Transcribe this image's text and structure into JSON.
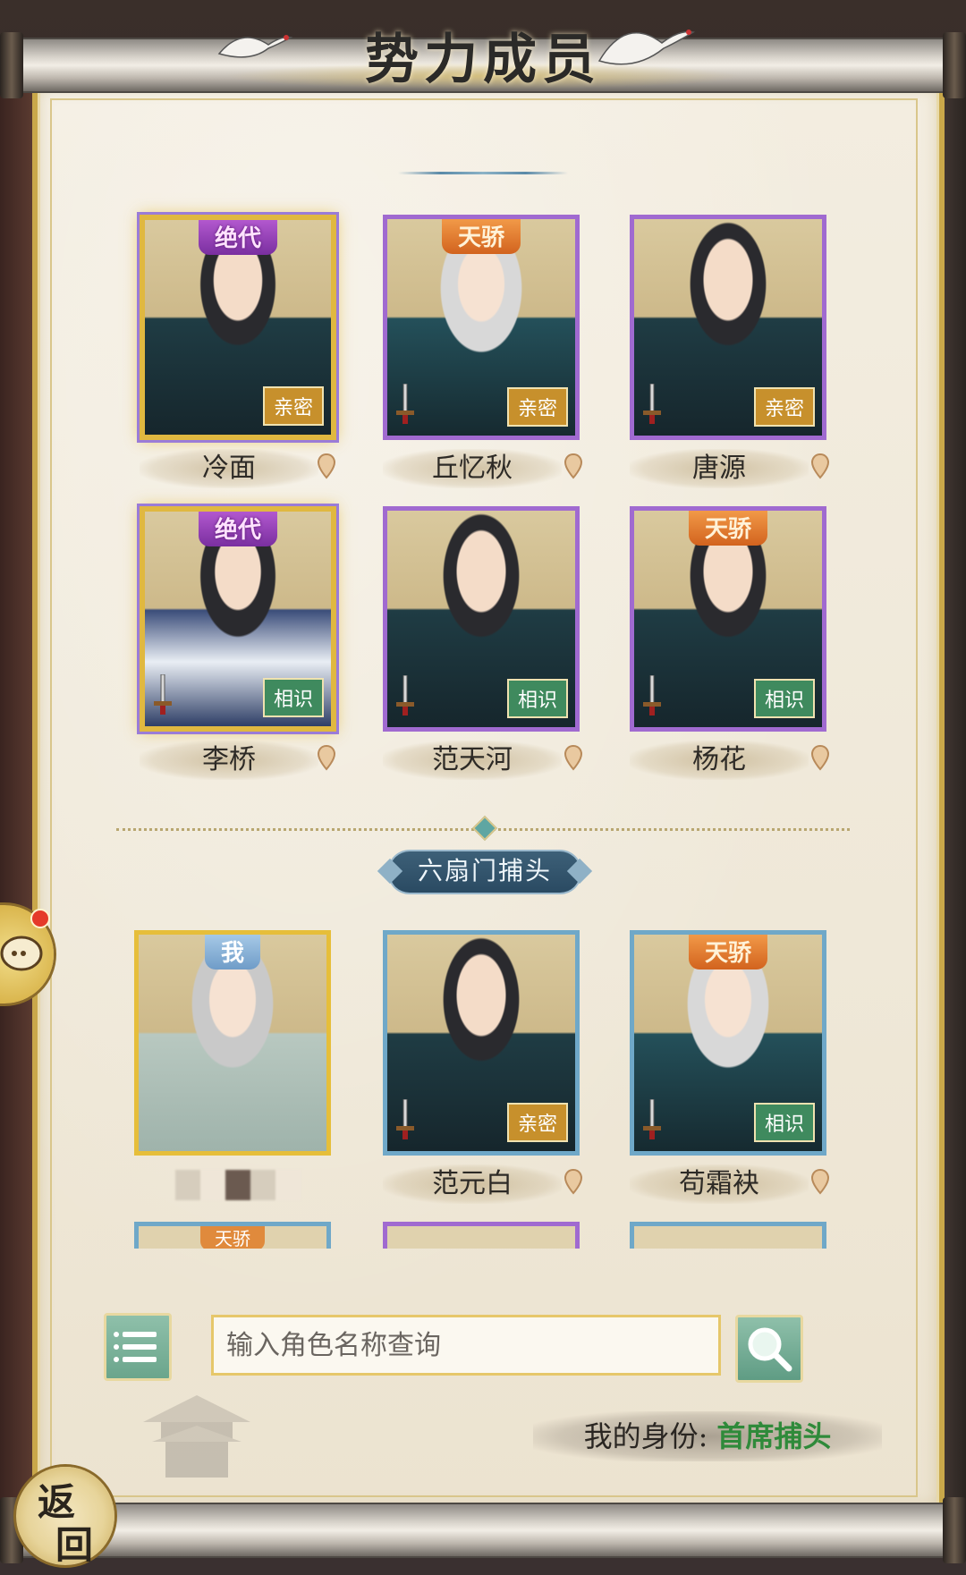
{
  "title": "势力成员",
  "members_top": [
    {
      "name": "冷面",
      "rank_tag": "绝代",
      "relation": "亲密",
      "style": "gold",
      "portrait": "dark"
    },
    {
      "name": "丘忆秋",
      "rank_tag": "天骄",
      "relation": "亲密",
      "style": "purple",
      "portrait": "silver"
    },
    {
      "name": "唐源",
      "rank_tag": "",
      "relation": "亲密",
      "style": "purple",
      "portrait": "dark"
    },
    {
      "name": "李桥",
      "rank_tag": "绝代",
      "relation": "相识",
      "style": "gold",
      "portrait": "blue-robe"
    },
    {
      "name": "范天河",
      "rank_tag": "",
      "relation": "相识",
      "style": "purple",
      "portrait": "dark"
    },
    {
      "name": "杨花",
      "rank_tag": "天骄",
      "relation": "相识",
      "style": "purple",
      "portrait": "dark"
    }
  ],
  "section_title": "六扇门捕头",
  "members_section": [
    {
      "name": "",
      "rank_tag": "我",
      "relation": "",
      "style": "me",
      "portrait": "pale"
    },
    {
      "name": "范元白",
      "rank_tag": "",
      "relation": "亲密",
      "style": "blue",
      "portrait": "dark"
    },
    {
      "name": "苟霜袂",
      "rank_tag": "天骄",
      "relation": "相识",
      "style": "blue",
      "portrait": "silver"
    }
  ],
  "peek_tags": [
    "天骄",
    "",
    ""
  ],
  "search": {
    "placeholder": "输入角色名称查询"
  },
  "identity": {
    "label": "我的身份:",
    "value": "首席捕头"
  },
  "back_label": {
    "char1": "返",
    "char2": "回"
  },
  "icons": {
    "menu": "list-menu-icon",
    "search": "magnifier-icon",
    "pin": "location-pin-icon",
    "sword": "sword-icon",
    "chat": "chat-bubble-icon"
  },
  "colors": {
    "gold_frame": "#e0b840",
    "purple_frame": "#a06ad0",
    "blue_frame": "#6fa8c8",
    "intimate_badge": "#c7902c",
    "known_badge": "#3f8a5e",
    "identity_value": "#2f8a3a"
  }
}
